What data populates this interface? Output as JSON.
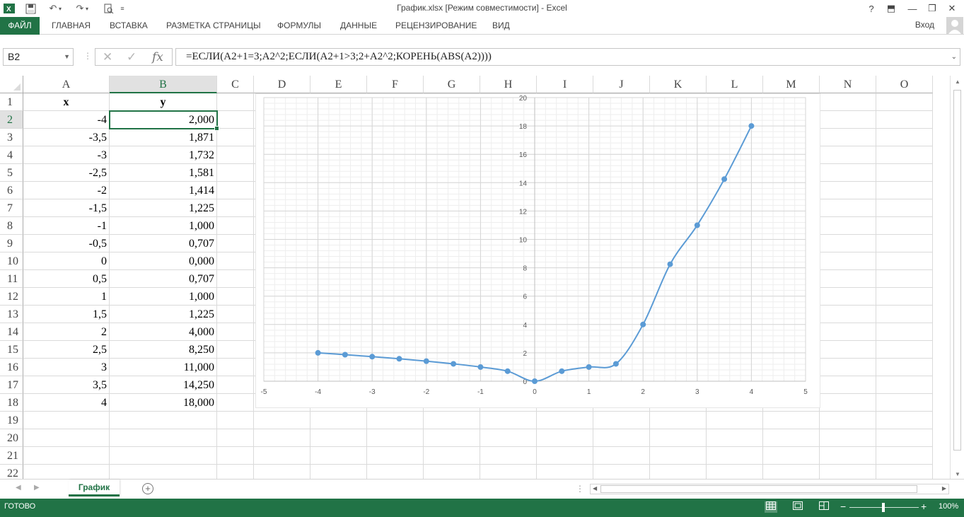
{
  "window": {
    "title": "График.xlsx  [Режим совместимости] - Excel",
    "icons": [
      "excel-logo-icon",
      "save-icon",
      "undo-icon",
      "redo-icon",
      "print-preview-icon",
      "customize-icon"
    ],
    "controls": {
      "help": "?",
      "ribbon_display": "⬒",
      "minimize": "—",
      "restore": "❐",
      "close": "✕"
    }
  },
  "ribbon": {
    "file_tab": "ФАЙЛ",
    "tabs": [
      "ГЛАВНАЯ",
      "ВСТАВКА",
      "РАЗМЕТКА СТРАНИЦЫ",
      "ФОРМУЛЫ",
      "ДАННЫЕ",
      "РЕЦЕНЗИРОВАНИЕ",
      "ВИД"
    ],
    "signin": "Вход"
  },
  "formula_bar": {
    "name_box": "B2",
    "cancel_glyph": "✕",
    "enter_glyph": "✓",
    "fx_glyph": "fx",
    "formula": "=ЕСЛИ(A2+1=3;A2^2;ЕСЛИ(A2+1>3;2+A2^2;КОРЕНЬ(ABS(A2))))"
  },
  "sheet": {
    "columns": [
      "A",
      "B",
      "C",
      "D",
      "E",
      "F",
      "G",
      "H",
      "I",
      "J",
      "K",
      "L",
      "M",
      "N",
      "O"
    ],
    "selected_column": "B",
    "rows": [
      "1",
      "2",
      "3",
      "4",
      "5",
      "6",
      "7",
      "8",
      "9",
      "10",
      "11",
      "12",
      "13",
      "14",
      "15",
      "16",
      "17",
      "18",
      "19",
      "20",
      "21",
      "22"
    ],
    "selected_row": "2",
    "header": {
      "x": "x",
      "y": "y"
    },
    "data": [
      {
        "x": "-4",
        "y": "2,000"
      },
      {
        "x": "-3,5",
        "y": "1,871"
      },
      {
        "x": "-3",
        "y": "1,732"
      },
      {
        "x": "-2,5",
        "y": "1,581"
      },
      {
        "x": "-2",
        "y": "1,414"
      },
      {
        "x": "-1,5",
        "y": "1,225"
      },
      {
        "x": "-1",
        "y": "1,000"
      },
      {
        "x": "-0,5",
        "y": "0,707"
      },
      {
        "x": "0",
        "y": "0,000"
      },
      {
        "x": "0,5",
        "y": "0,707"
      },
      {
        "x": "1",
        "y": "1,000"
      },
      {
        "x": "1,5",
        "y": "1,225"
      },
      {
        "x": "2",
        "y": "4,000"
      },
      {
        "x": "2,5",
        "y": "8,250"
      },
      {
        "x": "3",
        "y": "11,000"
      },
      {
        "x": "3,5",
        "y": "14,250"
      },
      {
        "x": "4",
        "y": "18,000"
      }
    ]
  },
  "chart_data": {
    "type": "scatter",
    "smooth_line": true,
    "marker": "circle",
    "series": [
      {
        "x": [
          -4,
          -3.5,
          -3,
          -2.5,
          -2,
          -1.5,
          -1,
          -0.5,
          0,
          0.5,
          1,
          1.5,
          2,
          2.5,
          3,
          3.5,
          4
        ],
        "y": [
          2,
          1.871,
          1.732,
          1.581,
          1.414,
          1.225,
          1,
          0.707,
          0,
          0.707,
          1,
          1.225,
          4,
          8.25,
          11,
          14.25,
          18
        ],
        "color": "#5b9bd5"
      }
    ],
    "xlim": [
      -5,
      5
    ],
    "ylim": [
      0,
      20
    ],
    "x_ticks": [
      "-5",
      "-4",
      "-3",
      "-2",
      "-1",
      "0",
      "1",
      "2",
      "3",
      "4",
      "5"
    ],
    "y_ticks": [
      "0",
      "2",
      "4",
      "6",
      "8",
      "10",
      "12",
      "14",
      "16",
      "18",
      "20"
    ],
    "x_major_step": 1,
    "y_major_step": 2,
    "x_minor_step": 0.2,
    "y_minor_step": 0.4,
    "grid": "major and minor",
    "y_axis_position": "at x = 0",
    "title": "",
    "xlabel": "",
    "ylabel": ""
  },
  "tabs_bar": {
    "sheet_tab": "График",
    "add_glyph": "+",
    "prev_glyph": "◀",
    "next_glyph": "▶"
  },
  "status_bar": {
    "status": "ГОТОВО",
    "zoom": "100%",
    "zoom_minus": "−",
    "zoom_plus": "+"
  },
  "colors": {
    "excel_green": "#217346",
    "series": "#5b9bd5",
    "gridline": "#dadada"
  }
}
